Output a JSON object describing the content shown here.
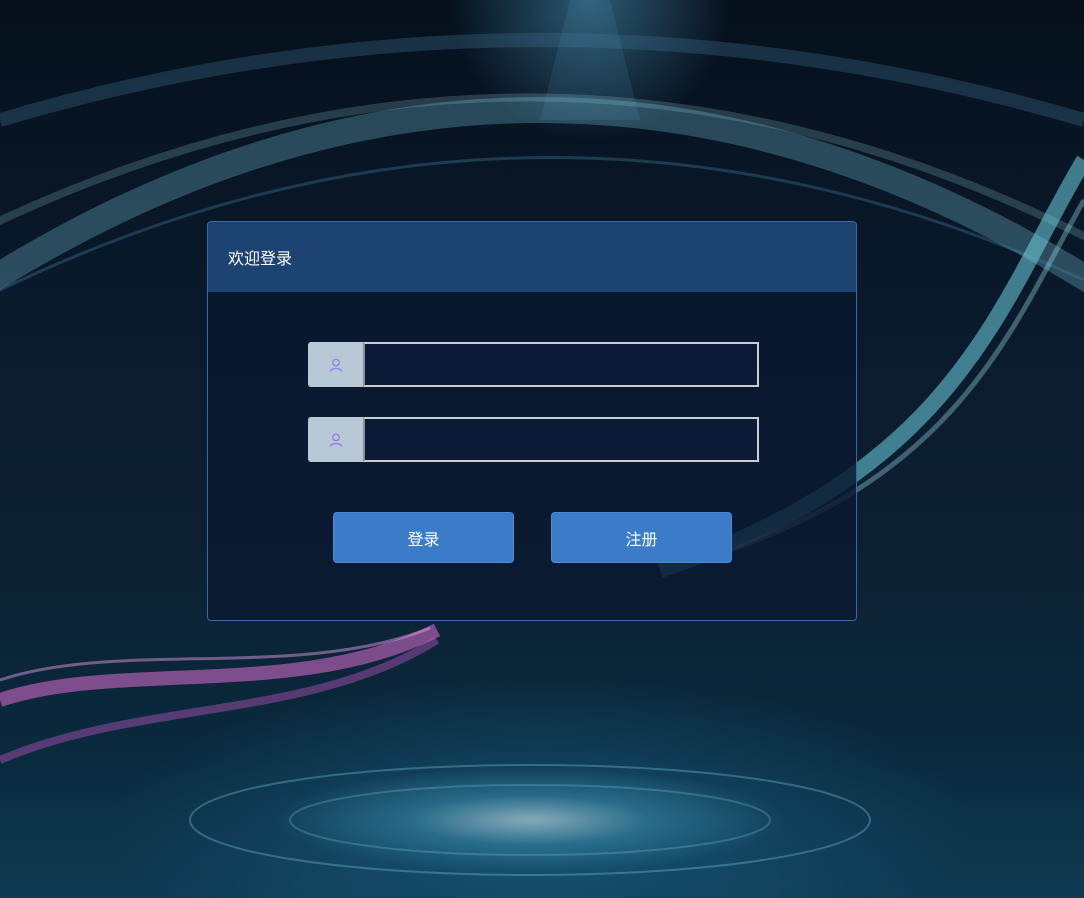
{
  "panel": {
    "title": "欢迎登录"
  },
  "form": {
    "username": {
      "icon": "user-icon",
      "value": "",
      "placeholder": ""
    },
    "password": {
      "icon": "user-icon",
      "value": "",
      "placeholder": ""
    }
  },
  "buttons": {
    "login_label": "登录",
    "register_label": "注册"
  },
  "colors": {
    "header": "#1d4372",
    "button": "#3b7cc9",
    "icon_addon": "#b9c8d6",
    "icon": "#8f7fe0"
  }
}
